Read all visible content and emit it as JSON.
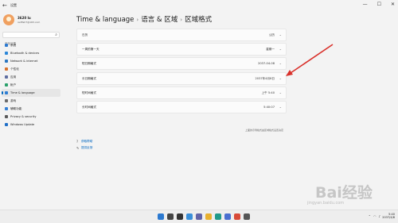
{
  "window": {
    "title": "设置",
    "controls": [
      "—",
      "☐",
      "✕"
    ]
  },
  "profile": {
    "name": "3620 lu",
    "email": "redfish7@163.com"
  },
  "search": {
    "placeholder": "查找设置"
  },
  "sidebar": {
    "items": [
      {
        "label": "系统",
        "icon": "system-icon",
        "color": "#2b79d0"
      },
      {
        "label": "Bluetooth & devices",
        "icon": "bluetooth-icon",
        "color": "#2a86d8"
      },
      {
        "label": "Network & internet",
        "icon": "network-icon",
        "color": "#2a76c0"
      },
      {
        "label": "个性化",
        "icon": "personalization-icon",
        "color": "#d8722c"
      },
      {
        "label": "应用",
        "icon": "apps-icon",
        "color": "#5e6da0"
      },
      {
        "label": "帐户",
        "icon": "accounts-icon",
        "color": "#2aa06a"
      },
      {
        "label": "Time & language",
        "icon": "time-language-icon",
        "color": "#2d7dd2",
        "active": true
      },
      {
        "label": "游戏",
        "icon": "gaming-icon",
        "color": "#6b6b6b"
      },
      {
        "label": "辅助功能",
        "icon": "accessibility-icon",
        "color": "#3580d6"
      },
      {
        "label": "Privacy & security",
        "icon": "shield-icon",
        "color": "#5a5a5a"
      },
      {
        "label": "Windows Update",
        "icon": "update-icon",
        "color": "#1f6fc7"
      }
    ]
  },
  "breadcrumb": [
    "Time & language",
    "语言 & 区域",
    "区域格式"
  ],
  "settings": [
    {
      "label": "日历",
      "value": "公历"
    },
    {
      "label": "一周的第一天",
      "value": "星期一"
    },
    {
      "label": "短日期格式",
      "value": "2037-04-08"
    },
    {
      "label": "长日期格式",
      "value": "2037年4月8日"
    },
    {
      "label": "短时间格式",
      "value": "上午 5:40"
    },
    {
      "label": "长时间格式",
      "value": "5:40:07"
    }
  ],
  "note": "上面的示例格式由区域格式设置决定",
  "links": [
    {
      "label": "获取帮助",
      "icon": "help-icon"
    },
    {
      "label": "提供反馈",
      "icon": "feedback-icon"
    }
  ],
  "taskbar": {
    "icons": [
      {
        "name": "start-icon",
        "color": "#2b79d0"
      },
      {
        "name": "search-icon",
        "color": "#444444"
      },
      {
        "name": "task-view-icon",
        "color": "#333333"
      },
      {
        "name": "widgets-icon",
        "color": "#3a8fd9"
      },
      {
        "name": "chat-icon",
        "color": "#6264a7"
      },
      {
        "name": "explorer-icon",
        "color": "#e8b030"
      },
      {
        "name": "edge-icon",
        "color": "#1f9a8a"
      },
      {
        "name": "store-icon",
        "color": "#4a6fd0"
      },
      {
        "name": "chrome-icon",
        "color": "#d84a38"
      },
      {
        "name": "settings-icon",
        "color": "#555555"
      }
    ],
    "time": "5:40",
    "date": "2037/4/8"
  },
  "watermark": {
    "brand": "Bai经验",
    "url": "jingyan.baidu.com"
  },
  "colors": {
    "accent": "#0067c0",
    "annotation_arrow": "#d9302a"
  }
}
